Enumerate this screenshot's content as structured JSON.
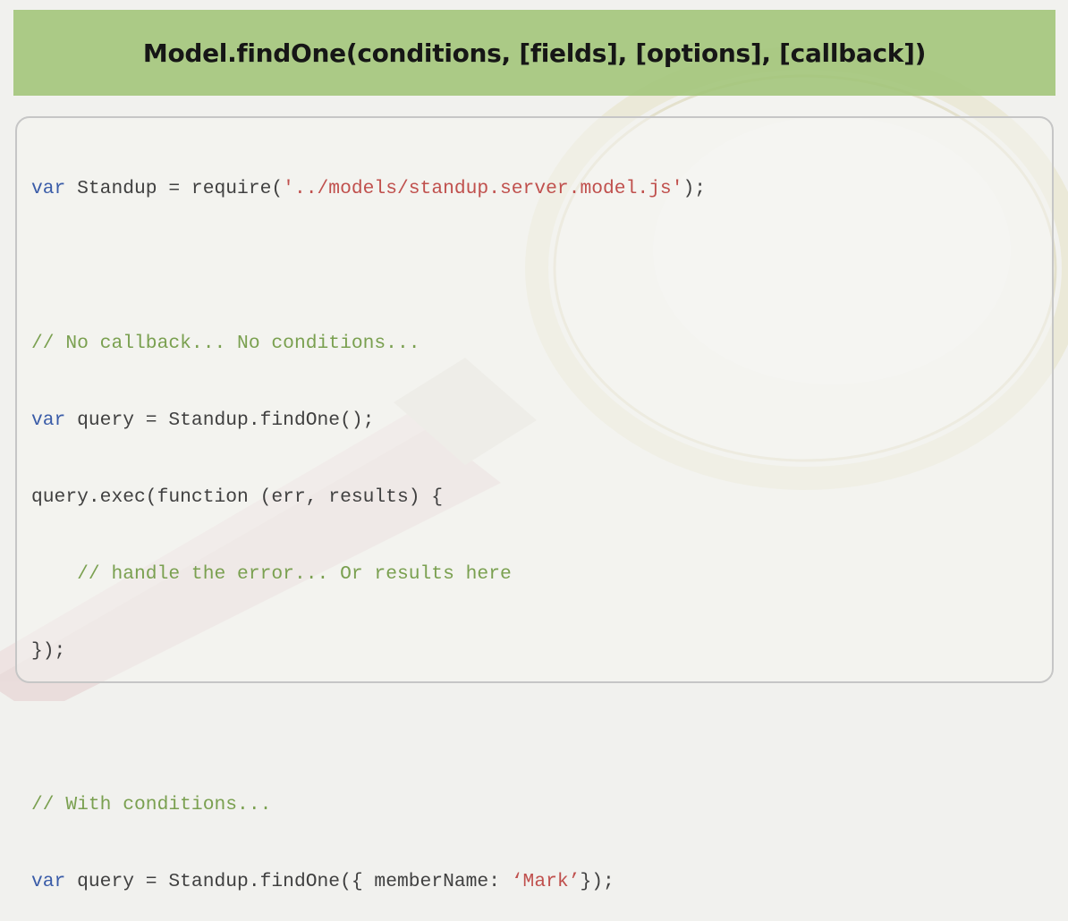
{
  "slide": {
    "title": "Model.findOne(conditions, [fields], [options], [callback])"
  },
  "code": {
    "line1": {
      "kw": "var",
      "a": " Standup = require(",
      "str": "'../models/standup.server.model.js'",
      "b": ");"
    },
    "line3": {
      "comment": "// No callback... No conditions..."
    },
    "line4": {
      "kw": "var",
      "a": " query = Standup.findOne();"
    },
    "line5": {
      "a": "query.exec(function (err, results) {"
    },
    "line6": {
      "indent": "    ",
      "comment": "// handle the error... Or results here"
    },
    "line7": {
      "a": "});"
    },
    "line9": {
      "comment": "// With conditions..."
    },
    "line10": {
      "kw": "var",
      "a": " query = Standup.findOne({ memberName: ",
      "str": "‘Mark’",
      "b": "});"
    }
  },
  "colors": {
    "title_bar": "#a0c478",
    "keyword": "#3a5ca8",
    "string": "#c0504d",
    "comment": "#7aa050",
    "text": "#404040"
  }
}
